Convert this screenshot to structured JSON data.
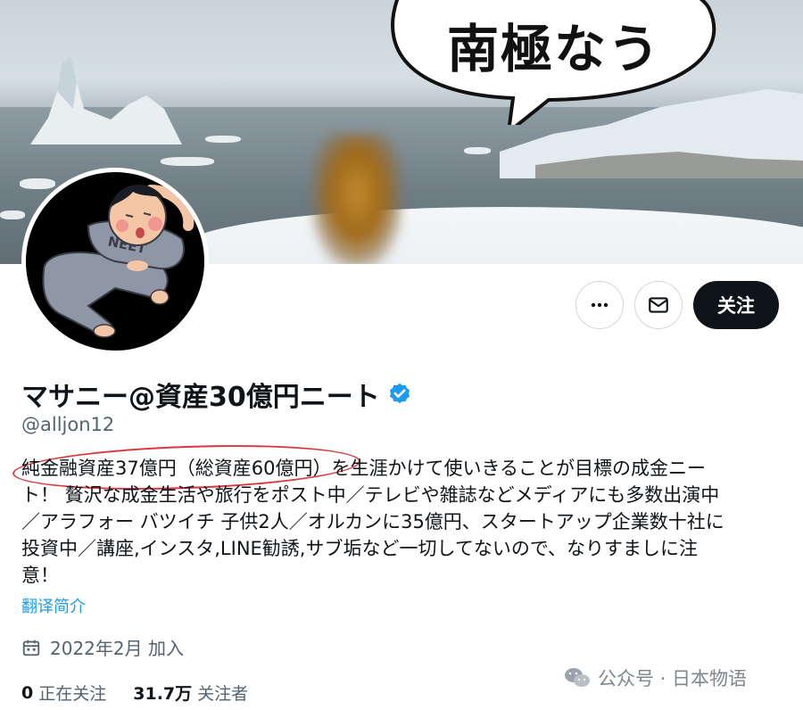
{
  "banner": {
    "speech_bubble_text": "南極なう"
  },
  "avatar": {
    "shirt_text": "NEET"
  },
  "actions": {
    "more_icon": "more-horizontal-icon",
    "message_icon": "envelope-icon",
    "follow_label": "关注"
  },
  "profile": {
    "display_name": "マサニー@資産30億円ニート",
    "verified_icon": "verified-badge-icon",
    "handle": "@alljon12",
    "bio_lines": [
      "純金融資産37億円（総資産60億円）を生涯かけて使いきることが目標の成金ニー",
      "ト！ 贅沢な成金生活や旅行をポスト中／テレビや雑誌などメディアにも多数出演中",
      "／アラフォー バツイチ 子供2人／オルカンに35億円、スタートアップ企業数十社に",
      "投資中／講座,インスタ,LINE勧誘,サブ垢など一切してないので、なりすましに注",
      "意！"
    ],
    "translate_link": "翻译简介",
    "joined_icon": "calendar-icon",
    "joined_text": "2022年2月 加入",
    "following_count": "0",
    "following_label": "正在关注",
    "followers_count": "31.7万",
    "followers_label": "关注者"
  },
  "watermark": {
    "icon": "wechat-icon",
    "text": "公众号 · 日本物语"
  },
  "colors": {
    "link_blue": "#1d9bf0",
    "verified_blue": "#1d9bf0",
    "follow_button_bg": "#0f1419",
    "annotation_red": "#d9363e",
    "secondary_text": "#536471"
  }
}
